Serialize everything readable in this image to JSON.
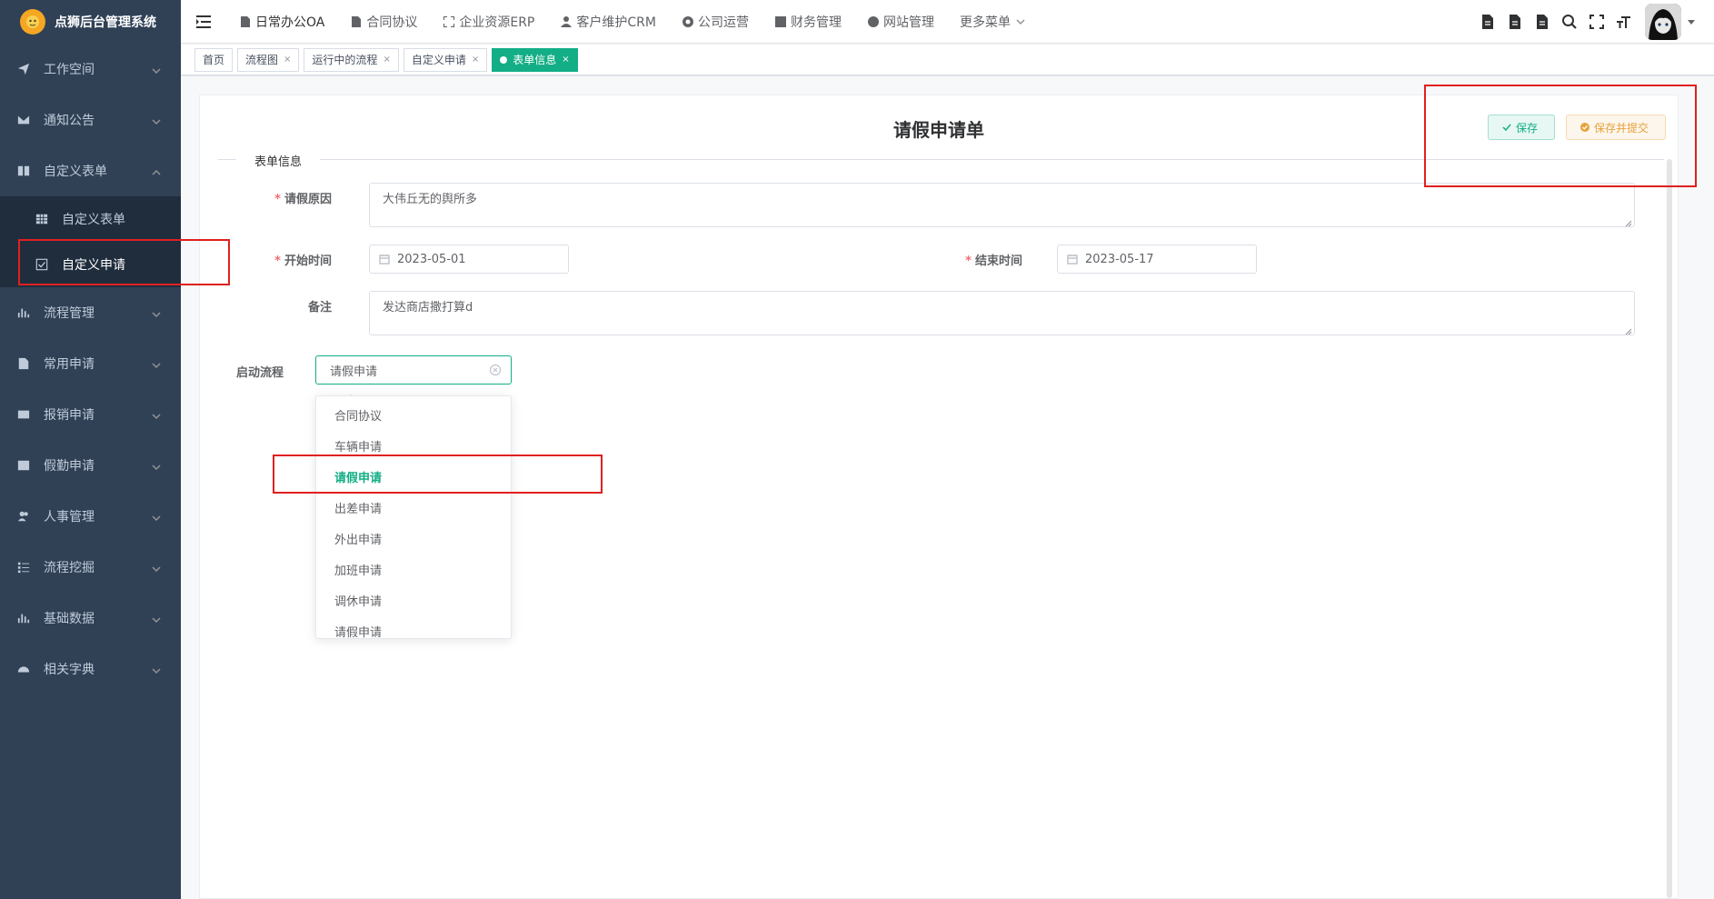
{
  "app": {
    "title": "点狮后台管理系统"
  },
  "sidebar": {
    "items": [
      {
        "label": "工作空间",
        "icon": "send-icon"
      },
      {
        "label": "通知公告",
        "icon": "mail-icon"
      },
      {
        "label": "自定义表单",
        "icon": "book-icon",
        "expanded": true
      },
      {
        "label": "流程管理",
        "icon": "bar-chart-icon"
      },
      {
        "label": "常用申请",
        "icon": "file-icon"
      },
      {
        "label": "报销申请",
        "icon": "id-card-icon"
      },
      {
        "label": "假勤申请",
        "icon": "table-icon"
      },
      {
        "label": "人事管理",
        "icon": "users-icon"
      },
      {
        "label": "流程挖掘",
        "icon": "list-icon"
      },
      {
        "label": "基础数据",
        "icon": "bar-chart-icon"
      },
      {
        "label": "相关字典",
        "icon": "dashboard-icon"
      }
    ],
    "submenu": [
      {
        "label": "自定义表单",
        "icon": "table-icon"
      },
      {
        "label": "自定义申请",
        "icon": "checkbox-icon",
        "active": true
      }
    ]
  },
  "topnav": {
    "items": [
      {
        "label": "日常办公OA",
        "icon": "doc-icon",
        "active": true
      },
      {
        "label": "合同协议",
        "icon": "doc-icon"
      },
      {
        "label": "企业资源ERP",
        "icon": "fullscreen-icon"
      },
      {
        "label": "客户维护CRM",
        "icon": "user-icon"
      },
      {
        "label": "公司运营",
        "icon": "chrome-icon"
      },
      {
        "label": "财务管理",
        "icon": "table-icon"
      },
      {
        "label": "网站管理",
        "icon": "globe-icon"
      },
      {
        "label": "更多菜单",
        "icon": ""
      }
    ]
  },
  "tags": [
    {
      "label": "首页",
      "closable": false
    },
    {
      "label": "流程图",
      "closable": true
    },
    {
      "label": "运行中的流程",
      "closable": true
    },
    {
      "label": "自定义申请",
      "closable": true
    },
    {
      "label": "表单信息",
      "closable": true,
      "active": true
    }
  ],
  "form": {
    "title": "请假申请单",
    "save_label": "保存",
    "submit_label": "保存并提交",
    "section_label": "表单信息",
    "reason_label": "请假原因",
    "reason_value": "大伟丘无的舆所多",
    "start_label": "开始时间",
    "start_value": "2023-05-01",
    "end_label": "结束时间",
    "end_value": "2023-05-17",
    "remark_label": "备注",
    "remark_value": "发达商店撒打算d",
    "process_label": "启动流程",
    "process_value": "请假申请",
    "process_options": [
      "合同协议",
      "车辆申请",
      "请假申请",
      "出差申请",
      "外出申请",
      "加班申请",
      "调休申请",
      "请假申请"
    ],
    "process_selected_index": 2
  },
  "colors": {
    "accent": "#13ae85",
    "sidebar_bg": "#304156",
    "highlight": "#e02020",
    "warning": "#e6a23c"
  }
}
